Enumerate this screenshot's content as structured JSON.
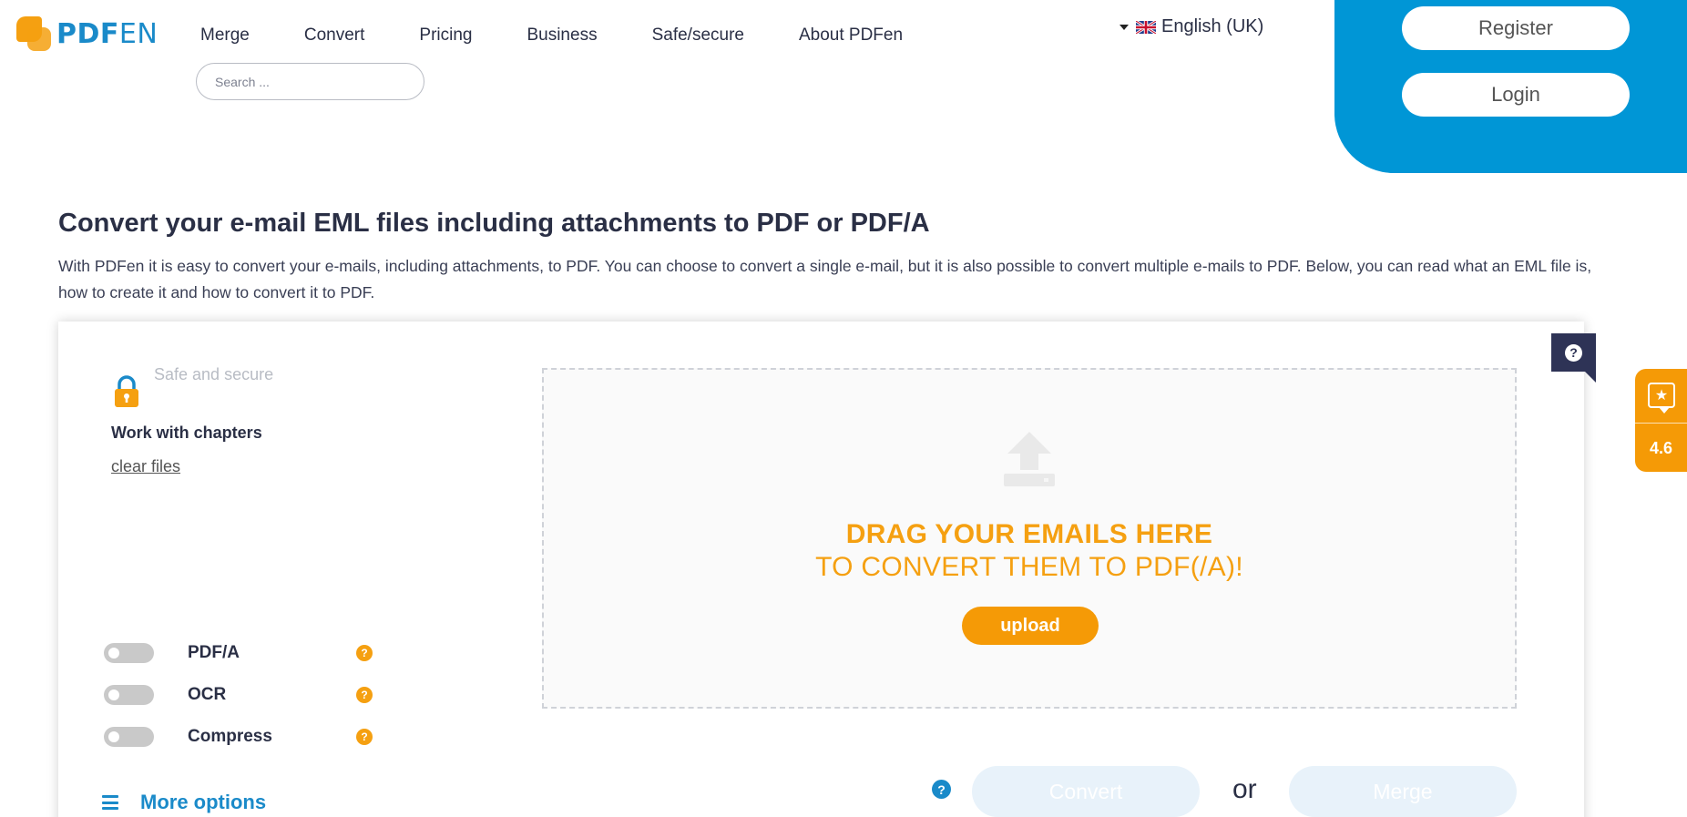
{
  "brand": {
    "logo_text_a": "PDF",
    "logo_text_b": "EN",
    "primary_color": "#1a8ac9",
    "accent_color": "#f5a011",
    "panel_color": "#0096d6"
  },
  "nav": {
    "items": [
      "Merge",
      "Convert",
      "Pricing",
      "Business",
      "Safe/secure",
      "About PDFen"
    ]
  },
  "search": {
    "placeholder": "Search ..."
  },
  "language": {
    "label": "English (UK)"
  },
  "account": {
    "register_label": "Register",
    "login_label": "Login"
  },
  "intro": {
    "title": "Convert your e-mail EML files including attachments to PDF or PDF/A",
    "text": "With PDFen it is easy to convert your e-mails, including attachments, to PDF. You can choose to convert a single e-mail, but it is also possible to convert multiple e-mails to PDF. Below, you can read what an EML file is, how to create it and how to convert it to PDF."
  },
  "converter": {
    "safe_label": "Safe and secure",
    "chapters_label": "Work with chapters",
    "clear_label": "clear files",
    "options": [
      {
        "label": "PDF/A",
        "enabled": false
      },
      {
        "label": "OCR",
        "enabled": false
      },
      {
        "label": "Compress",
        "enabled": false
      }
    ],
    "more_options_label": "More options",
    "dropzone": {
      "line1": "DRAG YOUR EMAILS HERE",
      "line2": "TO CONVERT THEM TO PDF(/A)!",
      "upload_label": "upload"
    },
    "convert_label": "Convert",
    "or_label": "or",
    "merge_label": "Merge"
  },
  "rating": {
    "score": "4.6"
  }
}
